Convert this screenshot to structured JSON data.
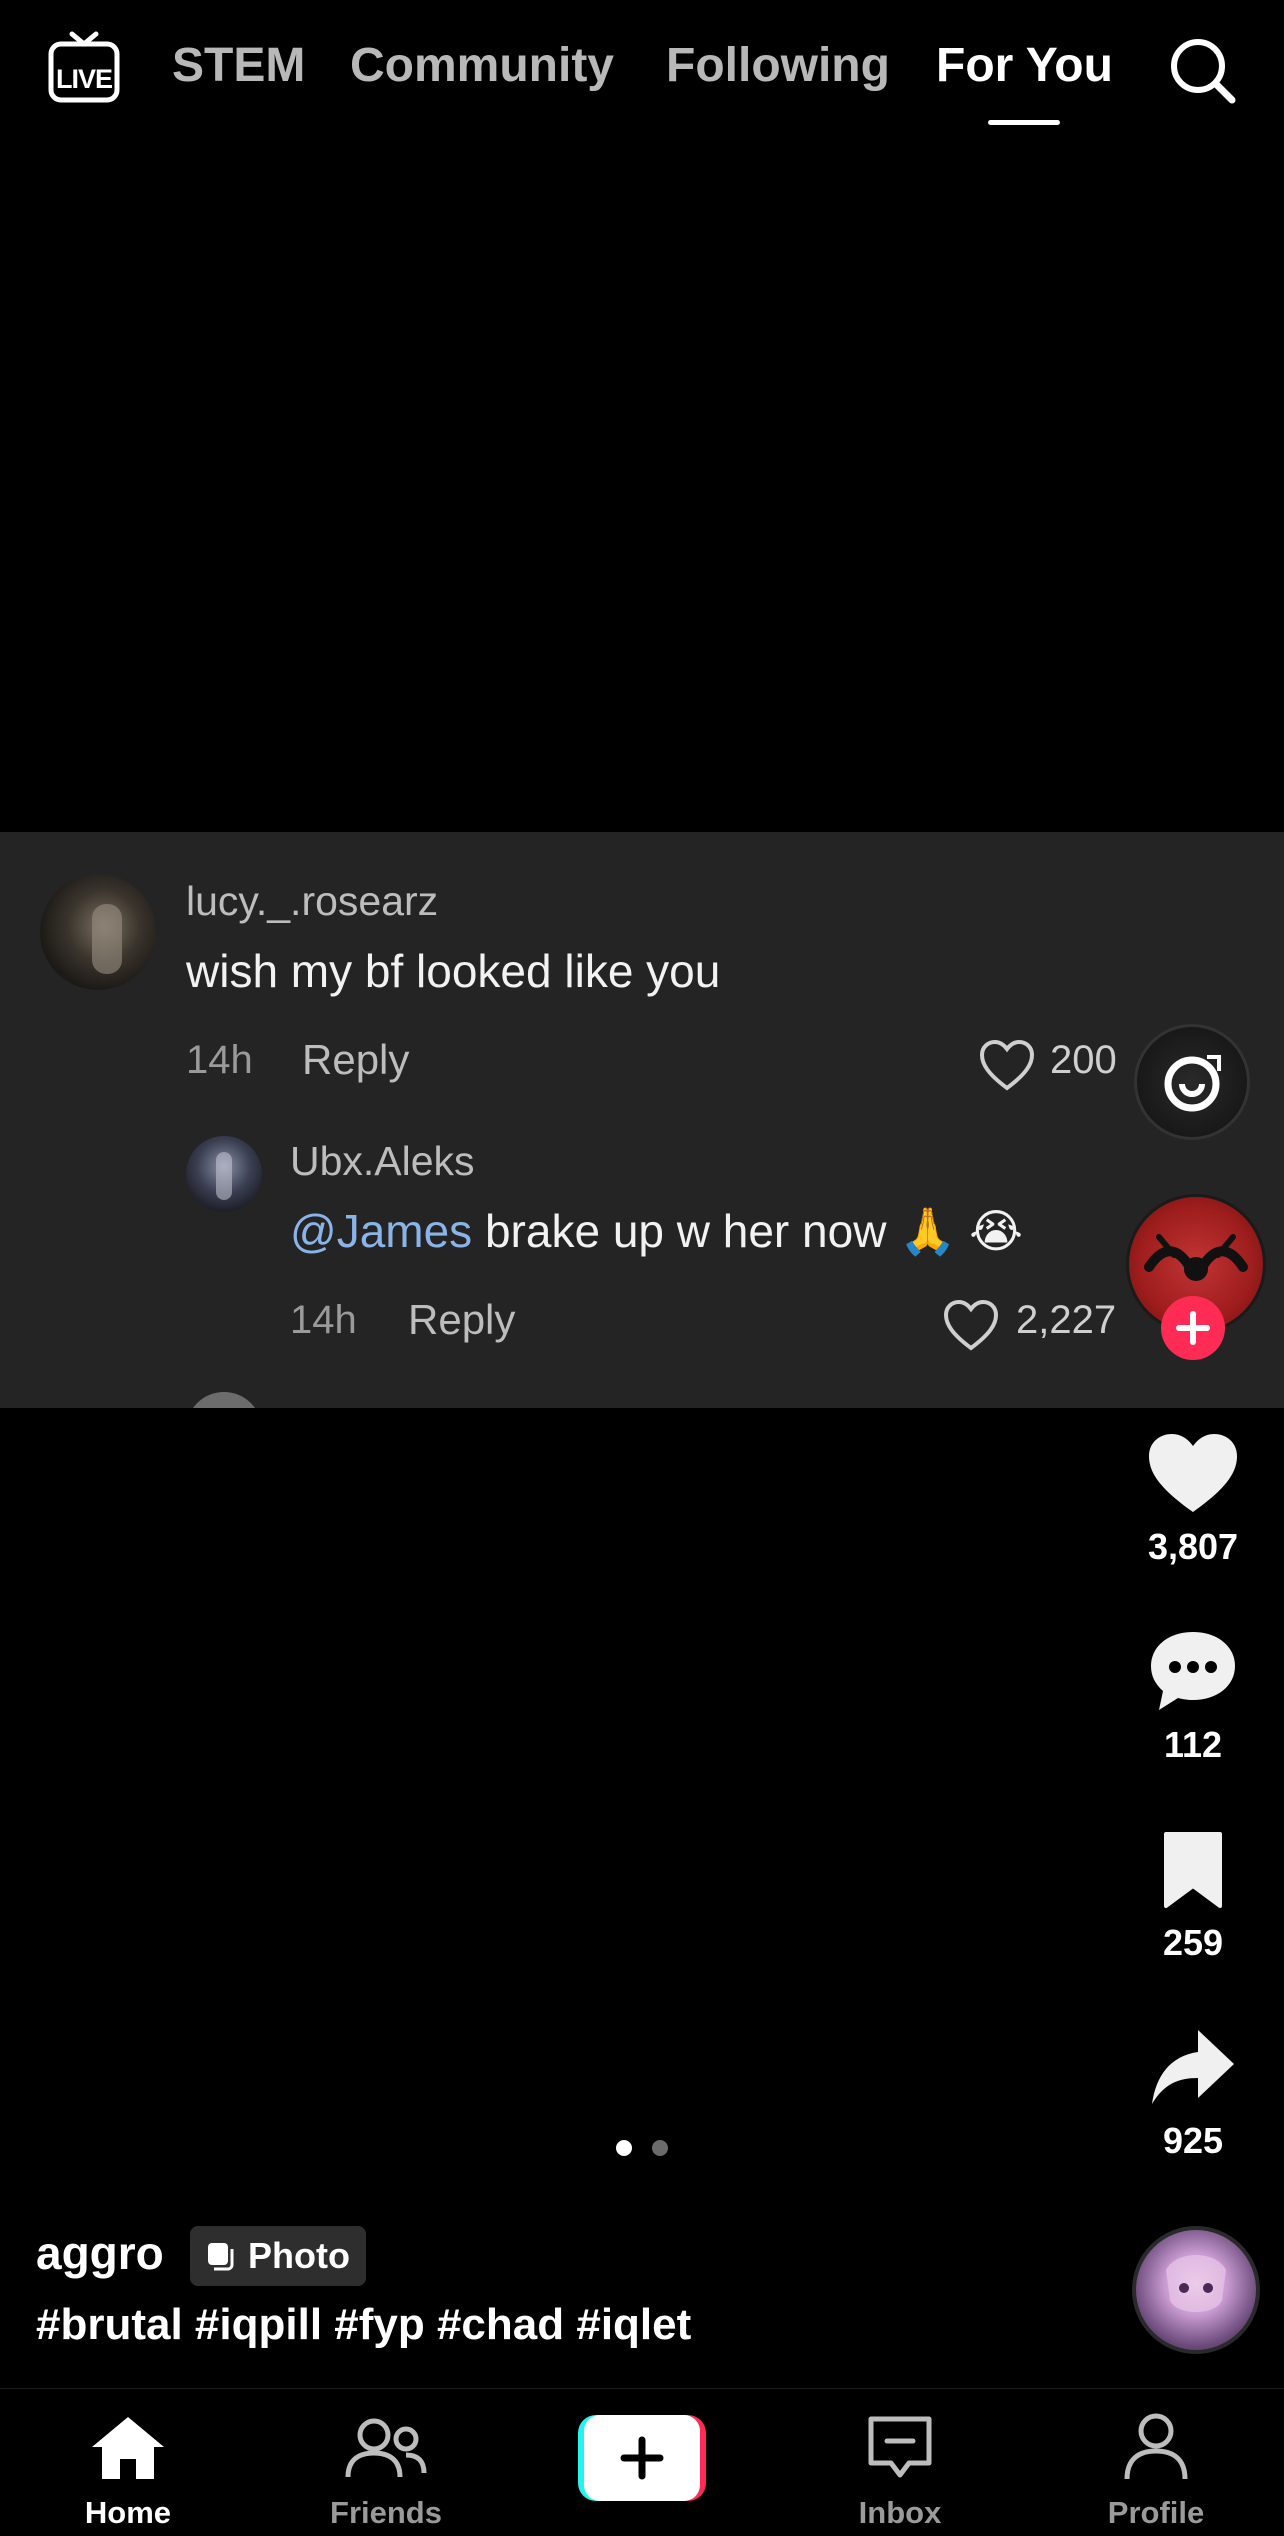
{
  "top_nav": {
    "live_icon_label": "LIVE",
    "tabs": [
      {
        "label": "STEM"
      },
      {
        "label": "Community"
      },
      {
        "label": "Following"
      },
      {
        "label": "For You"
      }
    ],
    "active_tab": "For You"
  },
  "comments": [
    {
      "username": "lucy._.rosearz",
      "text": "wish my bf looked like you",
      "time": "14h",
      "reply_label": "Reply",
      "likes": "200"
    },
    {
      "username": "Ubx.Aleks",
      "mention": "@James",
      "text": " brake up w her now 🙏 😭",
      "time": "14h",
      "reply_label": "Reply",
      "likes": "2,227"
    }
  ],
  "actions": {
    "likes": "3,807",
    "comments": "112",
    "bookmarks": "259",
    "shares": "925"
  },
  "carousel": {
    "page_count": 2,
    "current_page": 1
  },
  "post": {
    "author": "aggro",
    "badge": "Photo",
    "hashtags": "#brutal #iqpill #fyp #chad #iqlet"
  },
  "bottom_nav": {
    "items": [
      {
        "label": "Home",
        "active": true
      },
      {
        "label": "Friends",
        "active": false
      },
      {
        "label": "",
        "active": false
      },
      {
        "label": "Inbox",
        "active": false
      },
      {
        "label": "Profile",
        "active": false
      }
    ]
  },
  "colors": {
    "background": "#000000",
    "comment_panel": "#242424",
    "mention": "#8ab4e8",
    "follow_plus": "#fe2c55",
    "create_cyan": "#25f4ee",
    "create_red": "#fe2c55"
  }
}
